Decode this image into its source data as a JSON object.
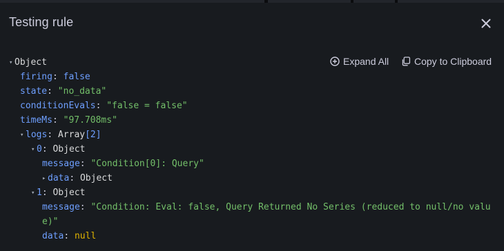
{
  "modal": {
    "title": "Testing rule",
    "close_icon": "close-icon"
  },
  "toolbar": {
    "expand_all_label": "Expand All",
    "copy_label": "Copy to Clipboard",
    "expand_icon": "plus-circle-icon",
    "copy_icon": "copy-icon"
  },
  "tree": {
    "root_type": "Object",
    "firing": {
      "key": "firing",
      "value": "false"
    },
    "state": {
      "key": "state",
      "value": "\"no_data\""
    },
    "conditionEvals": {
      "key": "conditionEvals",
      "value": "\"false = false\""
    },
    "timeMs": {
      "key": "timeMs",
      "value": "\"97.708ms\""
    },
    "logs": {
      "key": "logs",
      "type": "Array",
      "count": "[2]"
    },
    "log0": {
      "index": "0",
      "type": "Object",
      "message_key": "message",
      "message_value": "\"Condition[0]: Query\"",
      "data_key": "data",
      "data_type": "Object"
    },
    "log1": {
      "index": "1",
      "type": "Object",
      "message_key": "message",
      "message_value_line1": "\"Condition: Eval: false, Query Returned No Series (reduced to null/no valu",
      "message_value_line2": "e)\"",
      "data_key": "data",
      "data_value": "null"
    }
  }
}
